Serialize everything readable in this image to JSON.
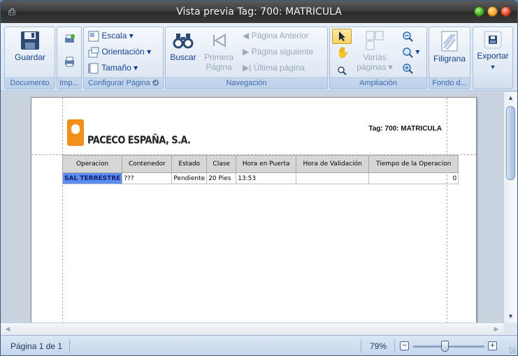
{
  "window": {
    "title": "Vista previa Tag: 700: MATRICULA"
  },
  "ribbon": {
    "documento": {
      "label": "Documento",
      "guardar": "Guardar"
    },
    "imprimir": {
      "label": "Imp..."
    },
    "configurar": {
      "label": "Configurar Página",
      "escala": "Escala",
      "orientacion": "Orientación",
      "tamano": "Tamaño"
    },
    "navegacion": {
      "label": "Navegación",
      "buscar": "Buscar",
      "primera_line1": "Primera",
      "primera_line2": "Página",
      "anterior": "Página Anterior",
      "siguiente": "Página siguiente",
      "ultima": "Última página"
    },
    "ampliacion": {
      "label": "Ampliación",
      "varias_line1": "Varias",
      "varias_line2": "páginas"
    },
    "fondo": {
      "label": "Fondo d...",
      "filigrana": "Filigrana"
    },
    "exportar": {
      "label": "Exportar"
    }
  },
  "report": {
    "company": "PACECO ESPAÑA, S.A.",
    "title": "Tag: 700: MATRICULA",
    "columns": [
      "Operacion",
      "Contenedor",
      "Estado",
      "Clase",
      "Hora en Puerta",
      "Hora de Validación",
      "Tiempo de la Operacion"
    ],
    "rows": [
      [
        "SAL TERRESTRE",
        "???",
        "Pendiente",
        "20 Pies",
        "13:53",
        "",
        "0"
      ]
    ]
  },
  "status": {
    "page": "Página 1 de 1",
    "zoom": "79%",
    "zoom_fraction": 0.45
  },
  "colors": {
    "selected_cell": "#5b8df0",
    "logo_orange": "#f0901a",
    "ribbon_text": "#15428b"
  }
}
